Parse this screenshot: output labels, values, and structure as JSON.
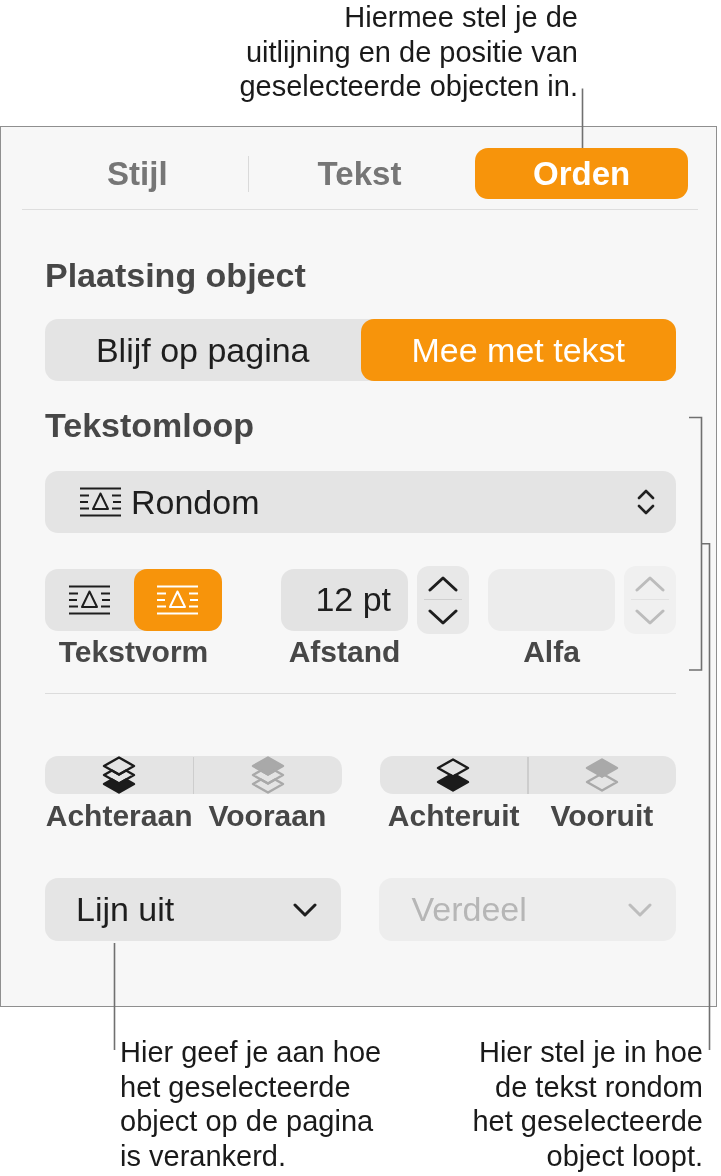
{
  "callouts": {
    "top": "Hiermee stel je de\nuitlijning en de positie van\ngeselecteerde objecten in.",
    "bottom_left": "Hier geef je aan hoe\nhet geselecteerde\nobject op de pagina\nis verankerd.",
    "bottom_right": "Hier stel je in hoe\nde tekst rondom\nhet geselecteerde\nobject loopt."
  },
  "tabs": [
    {
      "label": "Stijl",
      "selected": false
    },
    {
      "label": "Tekst",
      "selected": false
    },
    {
      "label": "Orden",
      "selected": true
    }
  ],
  "object_placement": {
    "heading": "Plaatsing object",
    "options": [
      {
        "label": "Blijf op pagina",
        "selected": false
      },
      {
        "label": "Mee met tekst",
        "selected": true
      }
    ]
  },
  "text_wrap": {
    "heading": "Tekstomloop",
    "style": "Rondom",
    "text_fit": {
      "label": "Tekstvorm",
      "options": [
        {
          "selected": false
        },
        {
          "selected": true
        }
      ]
    },
    "spacing": {
      "label": "Afstand",
      "value": "12 pt",
      "disabled": false
    },
    "alpha": {
      "label": "Alfa",
      "disabled": true
    }
  },
  "layer_groups": [
    {
      "buttons": [
        {
          "kind": "to_back",
          "label": "Achteraan",
          "disabled": false
        },
        {
          "kind": "to_front",
          "label": "Vooraan",
          "disabled": true
        }
      ]
    },
    {
      "buttons": [
        {
          "kind": "backward",
          "label": "Achteruit",
          "disabled": false
        },
        {
          "kind": "forward",
          "label": "Vooruit",
          "disabled": true
        }
      ]
    }
  ],
  "dropdowns": [
    {
      "value": "Lijn uit",
      "disabled": false
    },
    {
      "value": "Verdeel",
      "disabled": true
    }
  ]
}
